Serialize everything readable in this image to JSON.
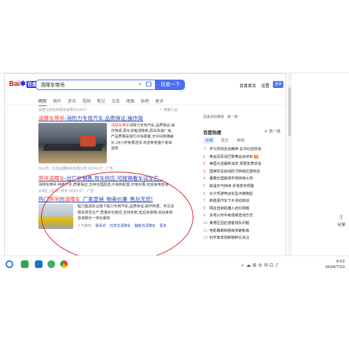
{
  "header": {
    "logo_text": "Bai",
    "logo_badge": "百度",
    "search_value": "清障车带吊",
    "search_button": "百度一下",
    "links": [
      "百度首页",
      "设置"
    ],
    "login": "登录"
  },
  "tabs": [
    "网页",
    "图片",
    "资讯",
    "视频",
    "笔记",
    "文库",
    "地图",
    "贴吧",
    "更多"
  ],
  "info_line": "百度为您找到相关结果约100个",
  "search_tools": "搜索工具",
  "results": [
    {
      "title_pre": "清障车带吊",
      "title_rest": "-消防力专用汽车,品质保证,操作简",
      "snippet_hl": "清障车带吊",
      "snippet": "清障力专用汽车,品质保证,操作简便,原车货箱清障牵,原车改装厂家,产品质量是我们对消费者,无中间商赚差价,24小时免费送货,欢迎新老客户前来选购",
      "source": "中山市 · 北京运腾商贸有限公司 2024-07",
      "tag": "广告"
    },
    {
      "title_pre": "带吊清障车",
      "title_rest": "-出厂价销售,现车供应,可按揭看车试车汇...",
      "snippet": "清障车带吊 种类齐全,质量保证,支持全国配送,中高档配置,价格实惠,欢迎来电咨询",
      "source": "云南汇 (北京) 技术 2024-07",
      "tag": "广告"
    },
    {
      "title_pre": "热门",
      "title_hl": "带吊",
      "title_mid": "的",
      "title_hl2": "清障车",
      "title_rest": "_厂家直销_物美价廉_售后无忧!",
      "snippet": "程力集团车业旗下程力专用汽车,品质保证,操作简便。专注清障车研发生产,质量好价格优,支持定制,售后有保障,欢迎来电咨询报价一体化服务",
      "links_label": "人气推荐",
      "links": [
        "悬吊式",
        "托举式清障车",
        "翻板式清障车",
        "更多"
      ]
    }
  ],
  "sidebar": {
    "ask": "百度百科推荐",
    "feedback": "换一换",
    "hot_title": "百度热搜",
    "hot_change": "换一换",
    "hot_tabs": [
      "热搜",
      "民生",
      "财经"
    ],
    "hot_list": [
      {
        "n": "↑",
        "text": "学习贯彻全会精神 总书记这样说",
        "top": true
      },
      {
        "n": "1",
        "text": "奥运冠军谈巴黎奥运会目标",
        "top": true,
        "badge": "热"
      },
      {
        "n": "2",
        "text": "美国大选最新消息 拜登发表讲话",
        "top": true
      },
      {
        "n": "3",
        "text": "国家防总启动防汛四级应急响应",
        "top": true
      },
      {
        "n": "4",
        "text": "暑期全国旅游市场持续火热",
        "top": false
      },
      {
        "n": "5",
        "text": "高温天气持续 多地发布预警",
        "top": false
      },
      {
        "n": "6",
        "text": "女子驾驶电动车坠河被救起",
        "top": false
      },
      {
        "n": "7",
        "text": "新能源汽车下乡活动启动",
        "top": false
      },
      {
        "n": "8",
        "text": "网友自制机器人走红网络",
        "top": false
      },
      {
        "n": "9",
        "text": "多地公布中考成绩查询方式",
        "top": false
      },
      {
        "n": "10",
        "text": "某景区回应游客排队问题",
        "top": false
      },
      {
        "n": "11",
        "text": "电影暑期档票房突破新高",
        "top": false
      },
      {
        "n": "12",
        "text": "科学家发现新物种引关注",
        "top": false
      }
    ]
  },
  "share": "分享",
  "taskbar": {
    "tray": "ㅅ  ☁  ⊞  ⊖  ✉  ⊡  ♪",
    "time": "9:52",
    "date": "2024/7/10"
  },
  "colors": {
    "accent": "#4e6ef2",
    "link": "#2440b3",
    "highlight": "#f73131",
    "annotation": "#d8202a"
  }
}
